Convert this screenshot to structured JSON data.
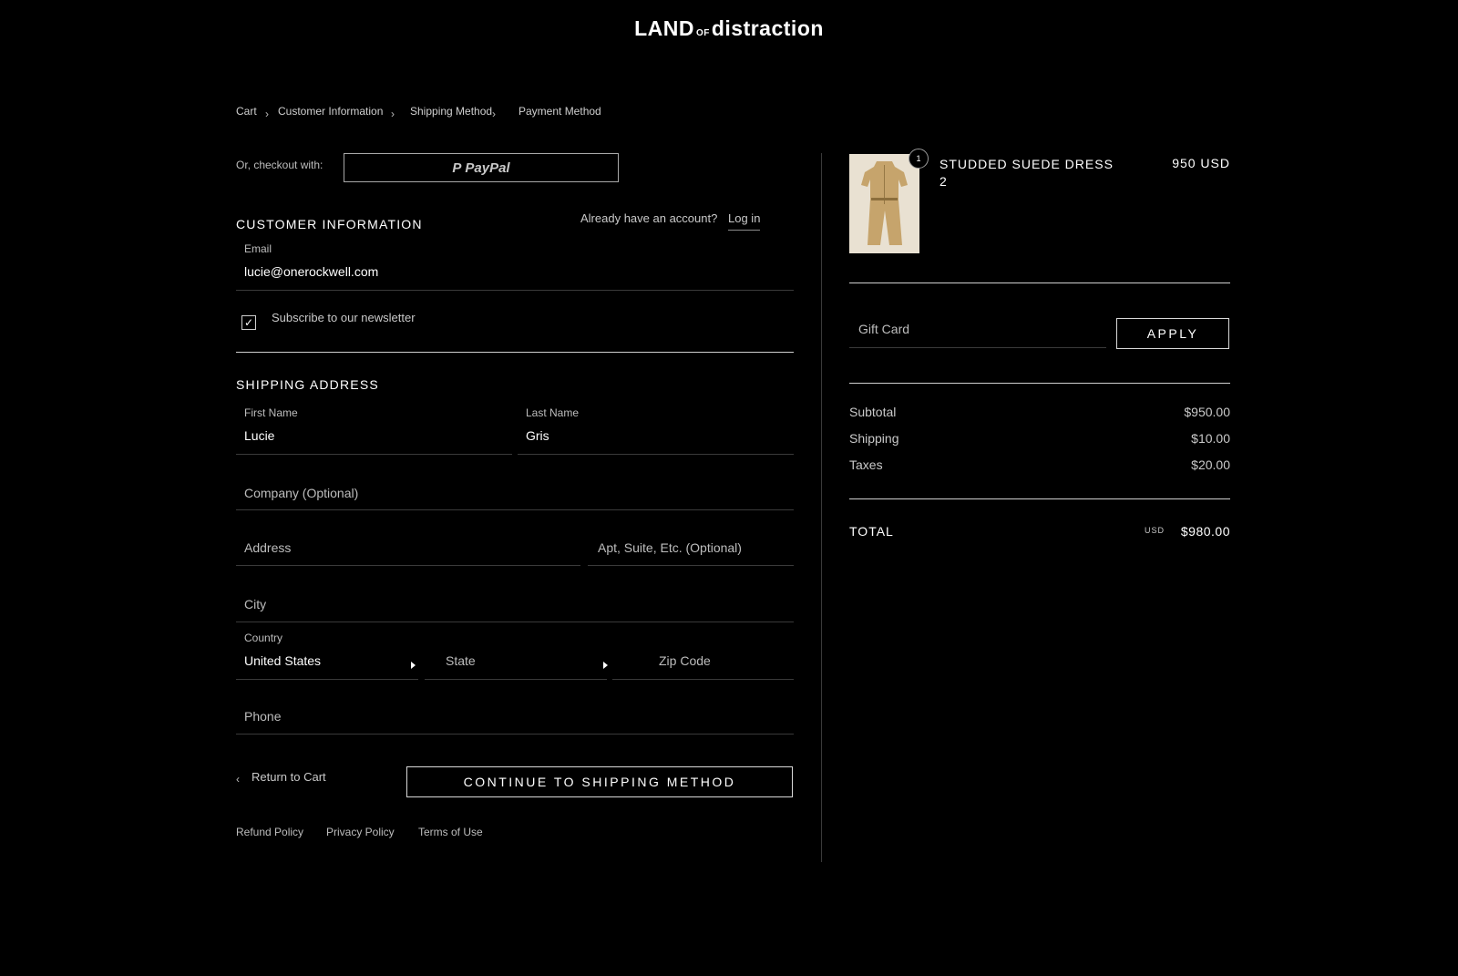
{
  "logo": {
    "part1": "LAND",
    "part2": "OF",
    "part3": "distraction"
  },
  "breadcrumb": [
    "Cart",
    "Customer Information",
    "Shipping Method",
    "Payment Method"
  ],
  "express": {
    "label": "Or, checkout with:",
    "paypal": "PayPal"
  },
  "customer": {
    "title": "CUSTOMER INFORMATION",
    "account_prompt": "Already have an account?",
    "login": "Log in",
    "email_label": "Email",
    "email_value": "lucie@onerockwell.com",
    "newsletter_label": "Subscribe to our newsletter",
    "newsletter_checked": true
  },
  "shipping": {
    "title": "SHIPPING ADDRESS",
    "first_name_label": "First Name",
    "first_name_value": "Lucie",
    "last_name_label": "Last Name",
    "last_name_value": "Gris",
    "company_placeholder": "Company (Optional)",
    "address_placeholder": "Address",
    "apt_placeholder": "Apt, Suite, Etc. (Optional)",
    "city_placeholder": "City",
    "country_label": "Country",
    "country_value": "United States",
    "state_placeholder": "State",
    "zip_placeholder": "Zip Code",
    "phone_placeholder": "Phone"
  },
  "actions": {
    "return_label": "Return to Cart",
    "continue_label": "CONTINUE TO SHIPPING METHOD"
  },
  "footer": [
    "Refund Policy",
    "Privacy Policy",
    "Terms of Use"
  ],
  "order": {
    "product_name_line1": "STUDDED SUEDE DRESS",
    "product_name_line2": "2",
    "product_price": "950 USD",
    "quantity": "1",
    "gift_card_placeholder": "Gift Card",
    "apply_label": "APPLY",
    "subtotal_label": "Subtotal",
    "subtotal_value": "$950.00",
    "shipping_label": "Shipping",
    "shipping_value": "$10.00",
    "taxes_label": "Taxes",
    "taxes_value": "$20.00",
    "total_label": "TOTAL",
    "total_currency": "USD",
    "total_value": "$980.00"
  },
  "colors": {
    "background": "#000000",
    "text": "#ffffff",
    "muted": "#c9c9c9",
    "divider": "#3a3a3a",
    "product_tan": "#c6a46c"
  }
}
